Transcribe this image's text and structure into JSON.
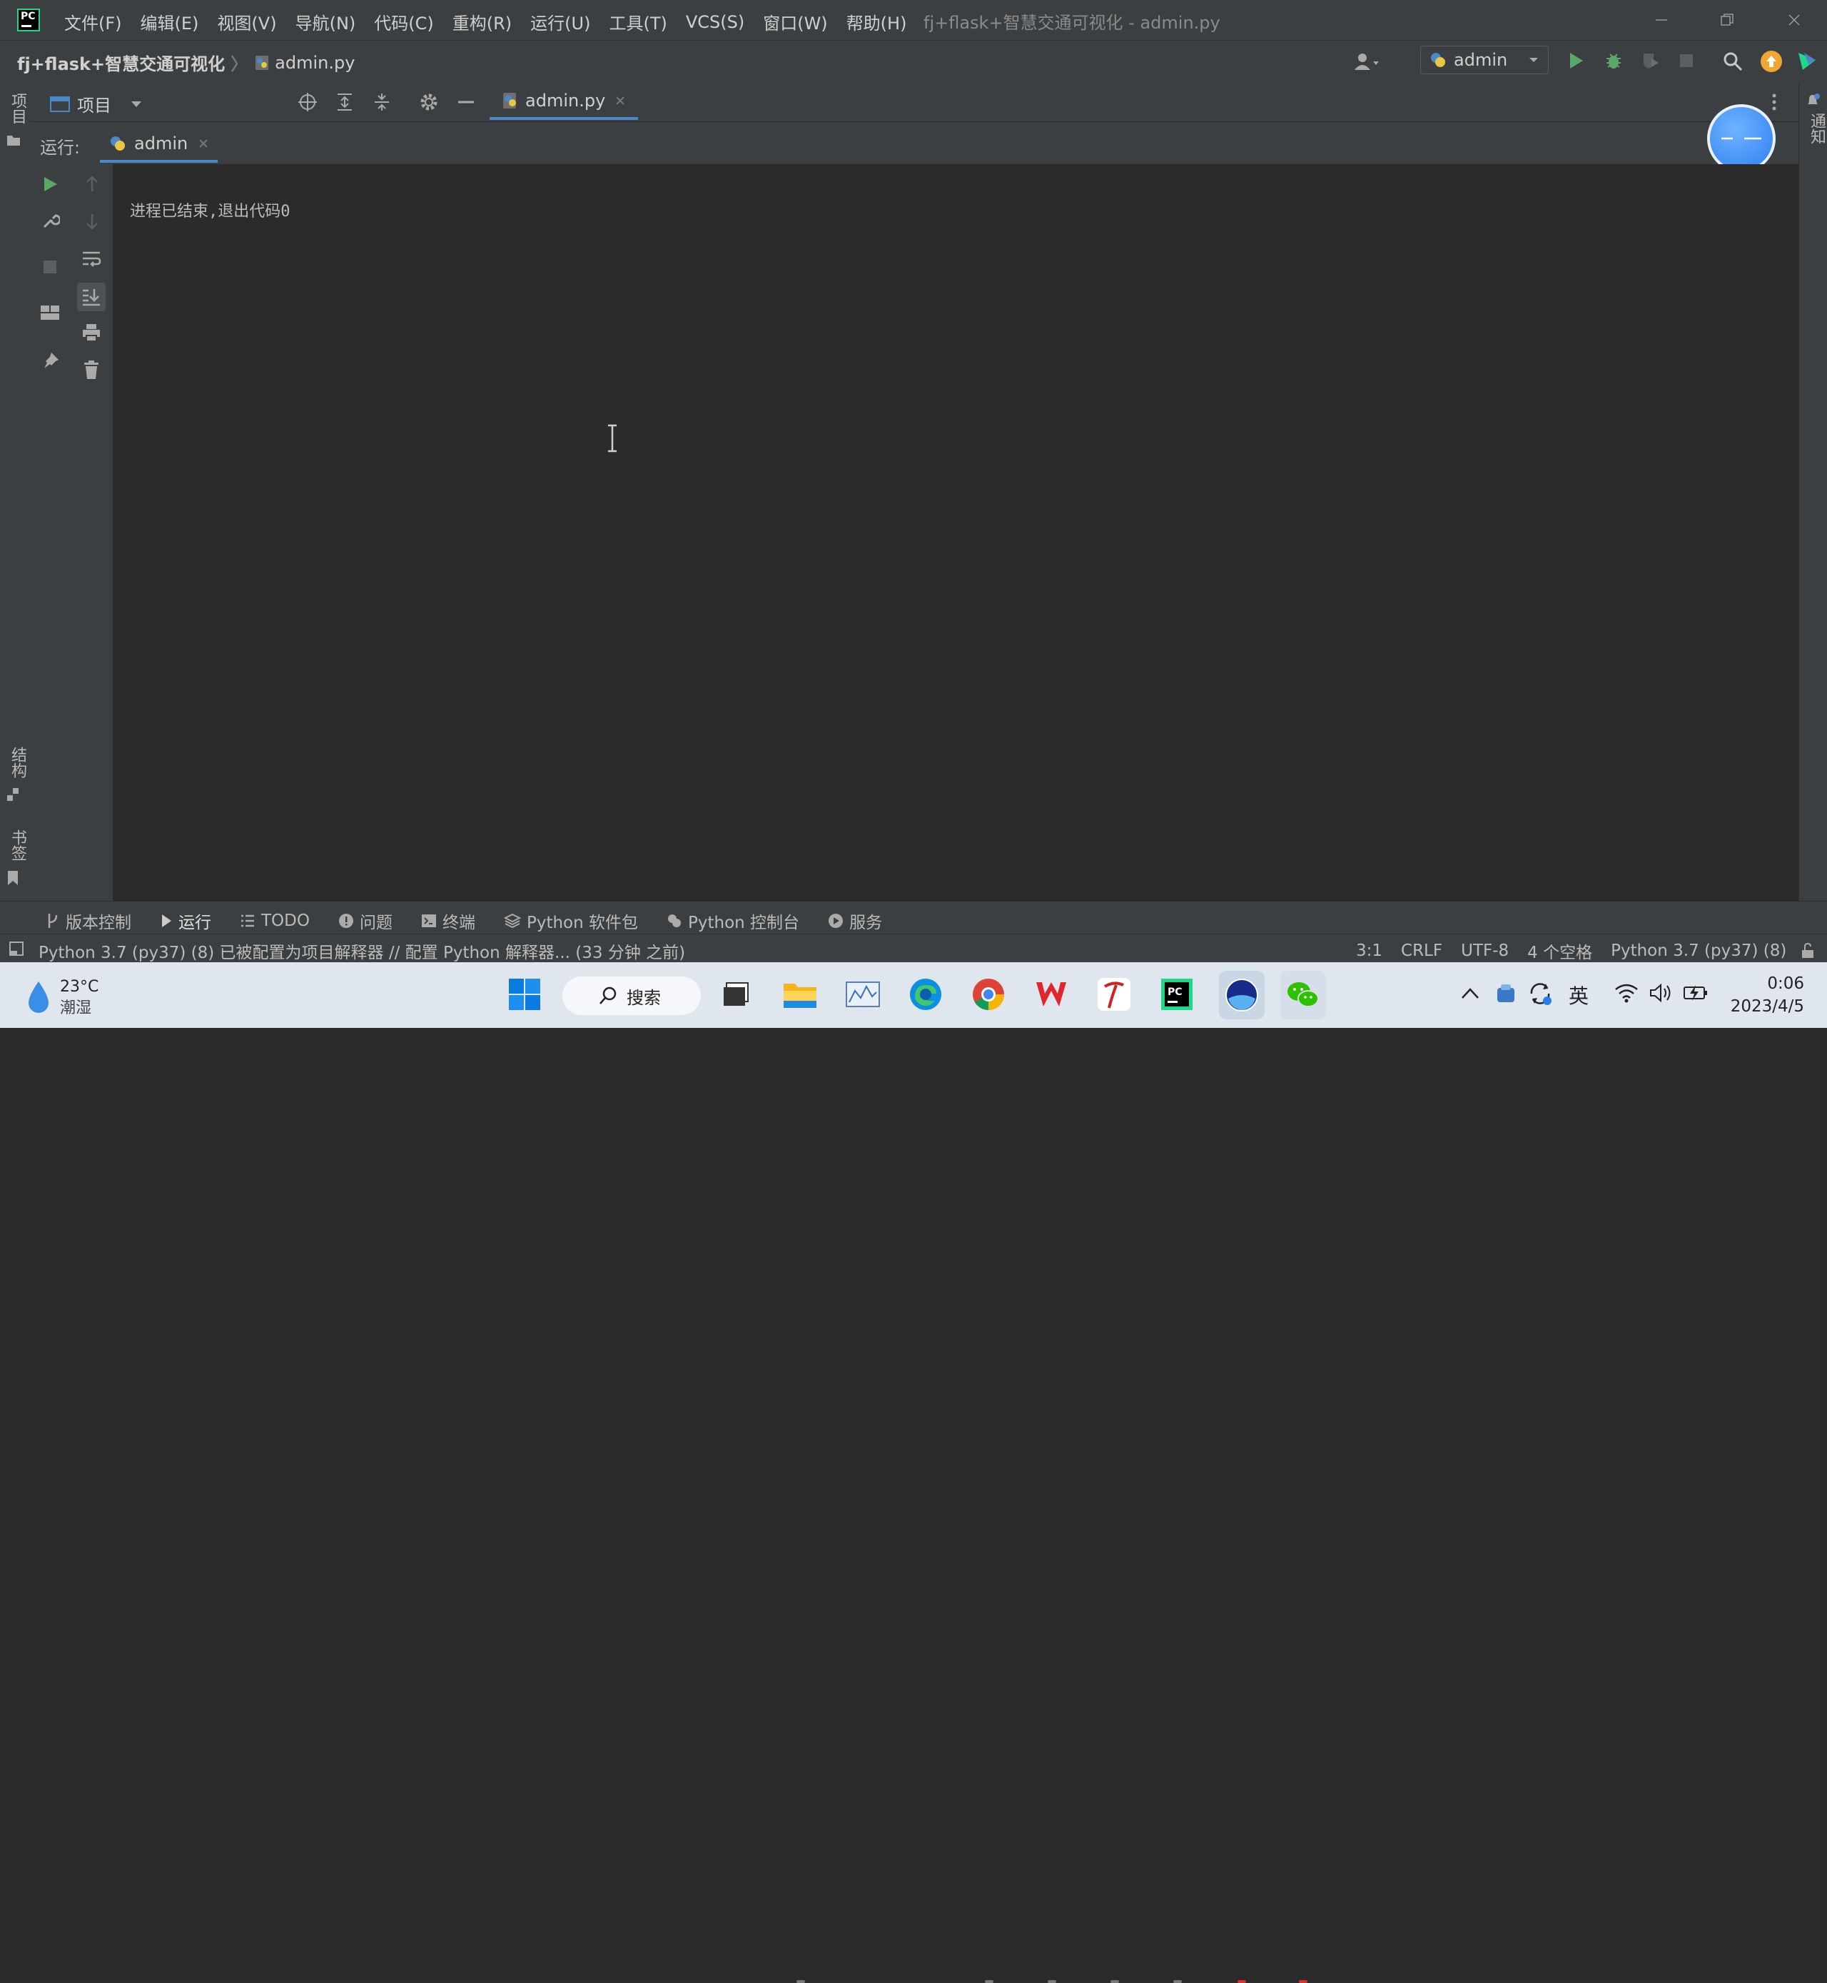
{
  "app": {
    "logo": "PC",
    "window_title": "fj+flask+智慧交通可视化 - admin.py",
    "menu": [
      "文件(F)",
      "编辑(E)",
      "视图(V)",
      "导航(N)",
      "代码(C)",
      "重构(R)",
      "运行(U)",
      "工具(T)",
      "VCS(S)",
      "窗口(W)",
      "帮助(H)"
    ]
  },
  "navbar": {
    "project": "fj+flask+智慧交通可视化",
    "file": "admin.py",
    "run_config": "admin"
  },
  "left_strip": {
    "project": "项目",
    "structure": "结构",
    "bookmarks": "书签"
  },
  "right_strip": {
    "notifications": "通知"
  },
  "project_panel": {
    "label": "项目"
  },
  "editor": {
    "tab": "admin.py"
  },
  "run_window": {
    "label": "运行:",
    "tab": "admin",
    "output": "进程已结束,退出代码0"
  },
  "bottom_tabs": [
    "版本控制",
    "运行",
    "TODO",
    "问题",
    "终端",
    "Python 软件包",
    "Python 控制台",
    "服务"
  ],
  "status": {
    "message": "Python 3.7 (py37) (8) 已被配置为项目解释器 // 配置 Python 解释器... (33 分钟 之前)",
    "position": "3:1",
    "line_sep": "CRLF",
    "encoding": "UTF-8",
    "indent": "4 个空格",
    "interpreter": "Python 3.7 (py37) (8)"
  },
  "taskbar": {
    "weather_temp": "23°C",
    "weather_desc": "潮湿",
    "search": "搜索",
    "ime": "英",
    "time": "0:06",
    "date": "2023/4/5"
  },
  "colors": {
    "accent": "#4a88c7",
    "run_green": "#59a869",
    "bg": "#2b2b2b",
    "panel": "#3c3f41"
  }
}
